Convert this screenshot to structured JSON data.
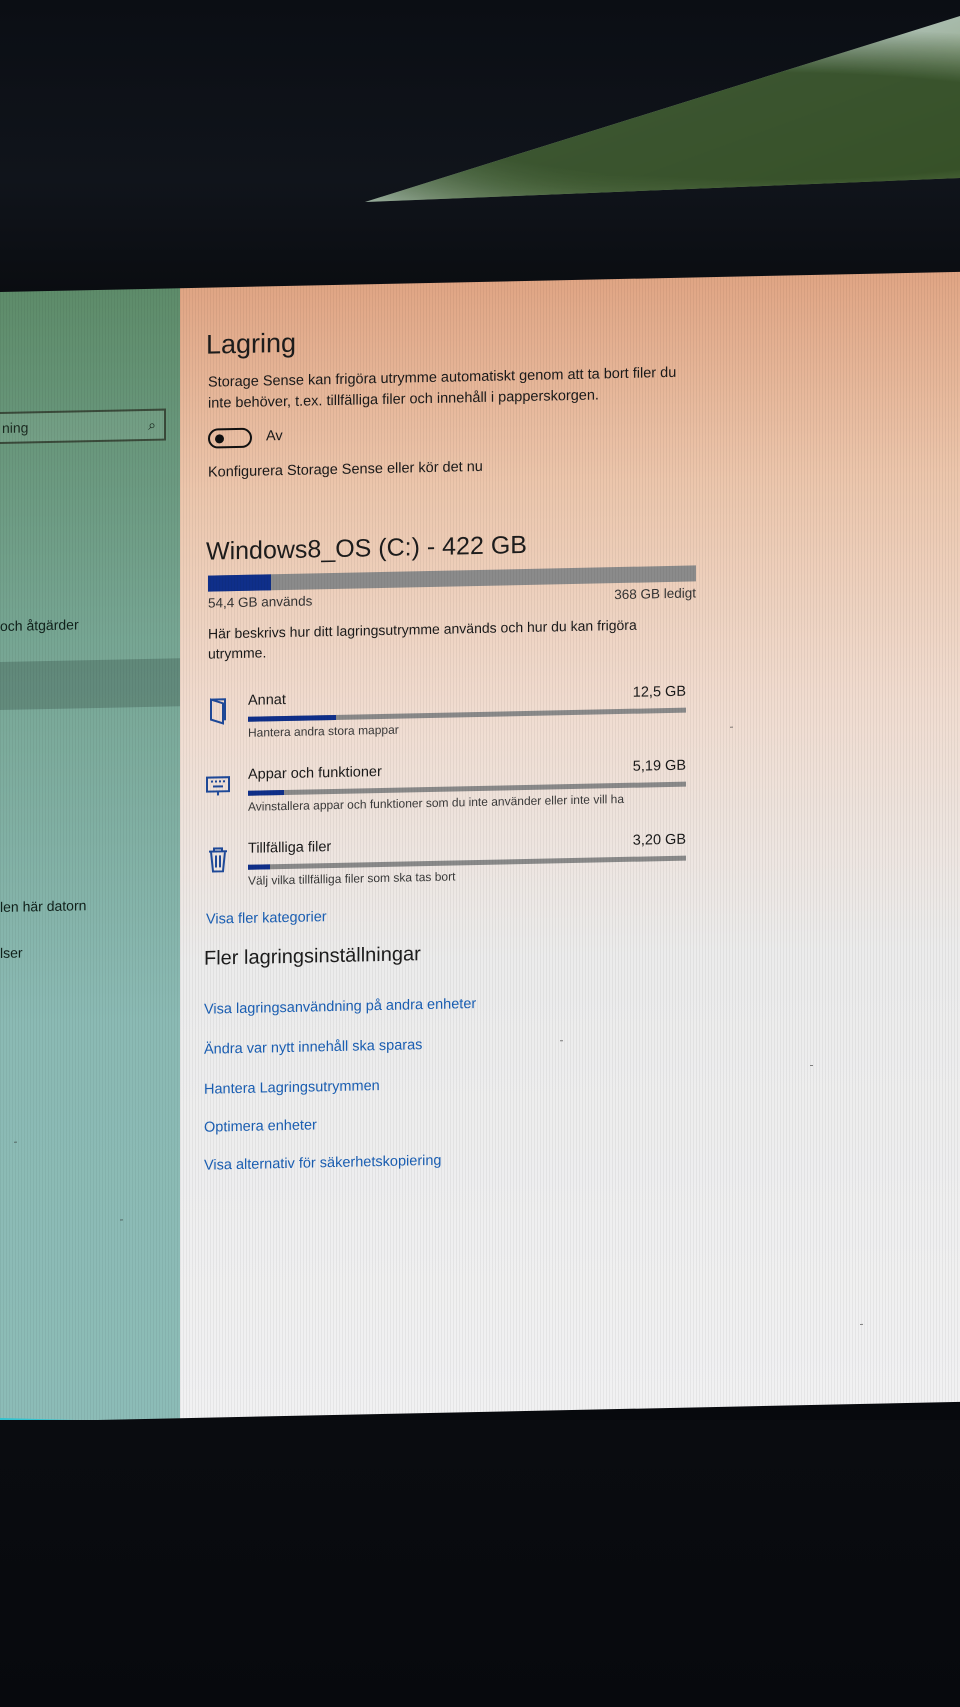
{
  "sidebar": {
    "search_text": "ning",
    "search_icon": "search-icon",
    "items": [
      "och åtgärder",
      "len här datorn",
      "lser"
    ]
  },
  "main": {
    "title": "Lagring",
    "description": "Storage Sense kan frigöra utrymme automatiskt genom att ta bort filer du inte behöver, t.ex. tillfälliga filer och innehåll i papperskorgen.",
    "toggle_state": "off",
    "toggle_label": "Av",
    "configure_link": "Konfigurera Storage Sense eller kör det nu",
    "drive": {
      "title": "Windows8_OS (C:) - 422 GB",
      "used_label": "54,4 GB används",
      "free_label": "368 GB ledigt",
      "used_fraction": 0.129
    },
    "explanation": "Här beskrivs hur ditt lagringsutrymme används och hur du kan frigöra utrymme.",
    "categories": [
      {
        "name": "Annat",
        "size": "12,5 GB",
        "sub": "Hantera andra stora mappar",
        "icon": "folder-icon",
        "fraction": 0.2
      },
      {
        "name": "Appar och funktioner",
        "size": "5,19 GB",
        "sub": "Avinstallera appar och funktioner som du inte använder eller inte vill ha",
        "icon": "keyboard-icon",
        "fraction": 0.083
      },
      {
        "name": "Tillfälliga filer",
        "size": "3,20 GB",
        "sub": "Välj vilka tillfälliga filer som ska tas bort",
        "icon": "trash-icon",
        "fraction": 0.05
      }
    ],
    "more_categories_link": "Visa fler kategorier",
    "more_settings_heading": "Fler lagringsinställningar",
    "more_links": [
      "Visa lagringsanvändning på andra enheter",
      "Ändra var nytt innehåll ska sparas",
      "Hantera Lagringsutrymmen",
      "Optimera enheter",
      "Visa alternativ för säkerhetskopiering"
    ]
  },
  "colors": {
    "accent": "#0f2f8a",
    "link": "#1a5fb4"
  }
}
